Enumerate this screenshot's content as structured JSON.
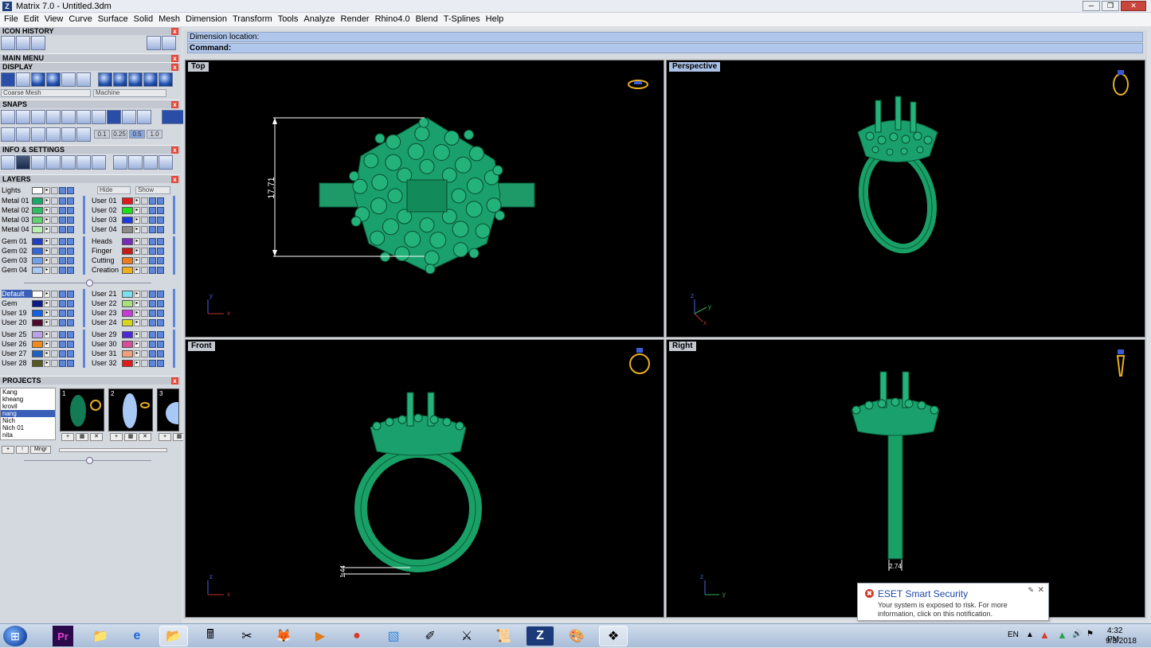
{
  "window": {
    "title": "Matrix 7.0 - Untitled.3dm",
    "app_icon": "Z",
    "min": "─",
    "max": "❐",
    "close": "✕"
  },
  "menu": [
    "File",
    "Edit",
    "View",
    "Curve",
    "Surface",
    "Solid",
    "Mesh",
    "Dimension",
    "Transform",
    "Tools",
    "Analyze",
    "Render",
    "Rhino4.0",
    "Blend",
    "T-Splines",
    "Help"
  ],
  "panel": {
    "sections": {
      "icon_history": "ICON HISTORY",
      "main_menu": "MAIN MENU",
      "display": "DISPLAY",
      "snaps": "SNAPS",
      "info": "INFO & SETTINGS",
      "layers": "LAYERS",
      "projects": "PROJECTS"
    },
    "display": {
      "mesh": "Coarse Mesh",
      "material": "Machine"
    },
    "snap_values": [
      "0.1",
      "0.25",
      "0.5",
      "1.0"
    ],
    "layers_top": {
      "lights": "Lights",
      "hide": "Hide",
      "show": "Show"
    },
    "layers": [
      {
        "name": "Metal 01",
        "color": "#1aa86a"
      },
      {
        "name": "Metal 02",
        "color": "#2fbf62"
      },
      {
        "name": "Metal 03",
        "color": "#5fd36c"
      },
      {
        "name": "Metal 04",
        "color": "#b7f0b0"
      },
      {
        "name": "Gem 01",
        "color": "#1f3fbf"
      },
      {
        "name": "Gem 02",
        "color": "#3566d9"
      },
      {
        "name": "Gem 03",
        "color": "#6fa0ee"
      },
      {
        "name": "Gem 04",
        "color": "#a8c8f5"
      },
      {
        "name": "Default",
        "color": "#ffffff"
      },
      {
        "name": "Gem",
        "color": "#0a1a8a"
      },
      {
        "name": "User 19",
        "color": "#1560e0"
      },
      {
        "name": "User 20",
        "color": "#4a0a2a"
      },
      {
        "name": "User 25",
        "color": "#b9a2e8"
      },
      {
        "name": "User 26",
        "color": "#f08a1a"
      },
      {
        "name": "User 27",
        "color": "#2060c0"
      },
      {
        "name": "User 28",
        "color": "#555a20"
      }
    ],
    "layers_right": [
      {
        "name": "User 01",
        "color": "#e01a1a"
      },
      {
        "name": "User 02",
        "color": "#1ae01a"
      },
      {
        "name": "User 03",
        "color": "#1a3ae0"
      },
      {
        "name": "User 04",
        "color": "#8a8a8a"
      },
      {
        "name": "Heads",
        "color": "#7a2ab8"
      },
      {
        "name": "Finger",
        "color": "#c81a1a"
      },
      {
        "name": "Cutting",
        "color": "#f07a1a"
      },
      {
        "name": "Creation",
        "color": "#f0b01a"
      },
      {
        "name": "User 21",
        "color": "#7ae0f0"
      },
      {
        "name": "User 22",
        "color": "#a8e07a"
      },
      {
        "name": "User 23",
        "color": "#c83ad8"
      },
      {
        "name": "User 24",
        "color": "#d8d81a"
      },
      {
        "name": "User 29",
        "color": "#4a2ad8"
      },
      {
        "name": "User 30",
        "color": "#d84a9a"
      },
      {
        "name": "User 31",
        "color": "#f0a07a"
      },
      {
        "name": "User 32",
        "color": "#e01a1a"
      }
    ],
    "projects": [
      "Kang",
      "kheang",
      "krovil",
      "nang",
      "Nich",
      "Nich 01",
      "nita"
    ],
    "selected_project": "nang",
    "project_thumbs": [
      "1",
      "2",
      "3"
    ],
    "mngr": "Mngr"
  },
  "command": {
    "line1": "Dimension location:",
    "line2": "Command:"
  },
  "viewports": {
    "top": "Top",
    "perspective": "Perspective",
    "front": "Front",
    "right": "Right"
  },
  "dims": {
    "top_height": "17.71",
    "front_thick": "1.44",
    "right_width": "2.74"
  },
  "axes": {
    "x": "x",
    "y": "y",
    "z": "z"
  },
  "notification": {
    "title": "ESET Smart Security",
    "body": "Your system is exposed to risk. For more information, click on this notification.",
    "icon": "✖",
    "close": "✕",
    "pin": "✎"
  },
  "taskbar": {
    "lang": "EN",
    "time": "4:32 PM",
    "date": "9/3/2018",
    "items": [
      "Pr",
      "📁",
      "e",
      "📂",
      "🖩",
      "✂",
      "🦊",
      "▶",
      "●",
      "▧",
      "✐",
      "⚔",
      "📜",
      "Z",
      "🎨",
      "❖"
    ]
  }
}
